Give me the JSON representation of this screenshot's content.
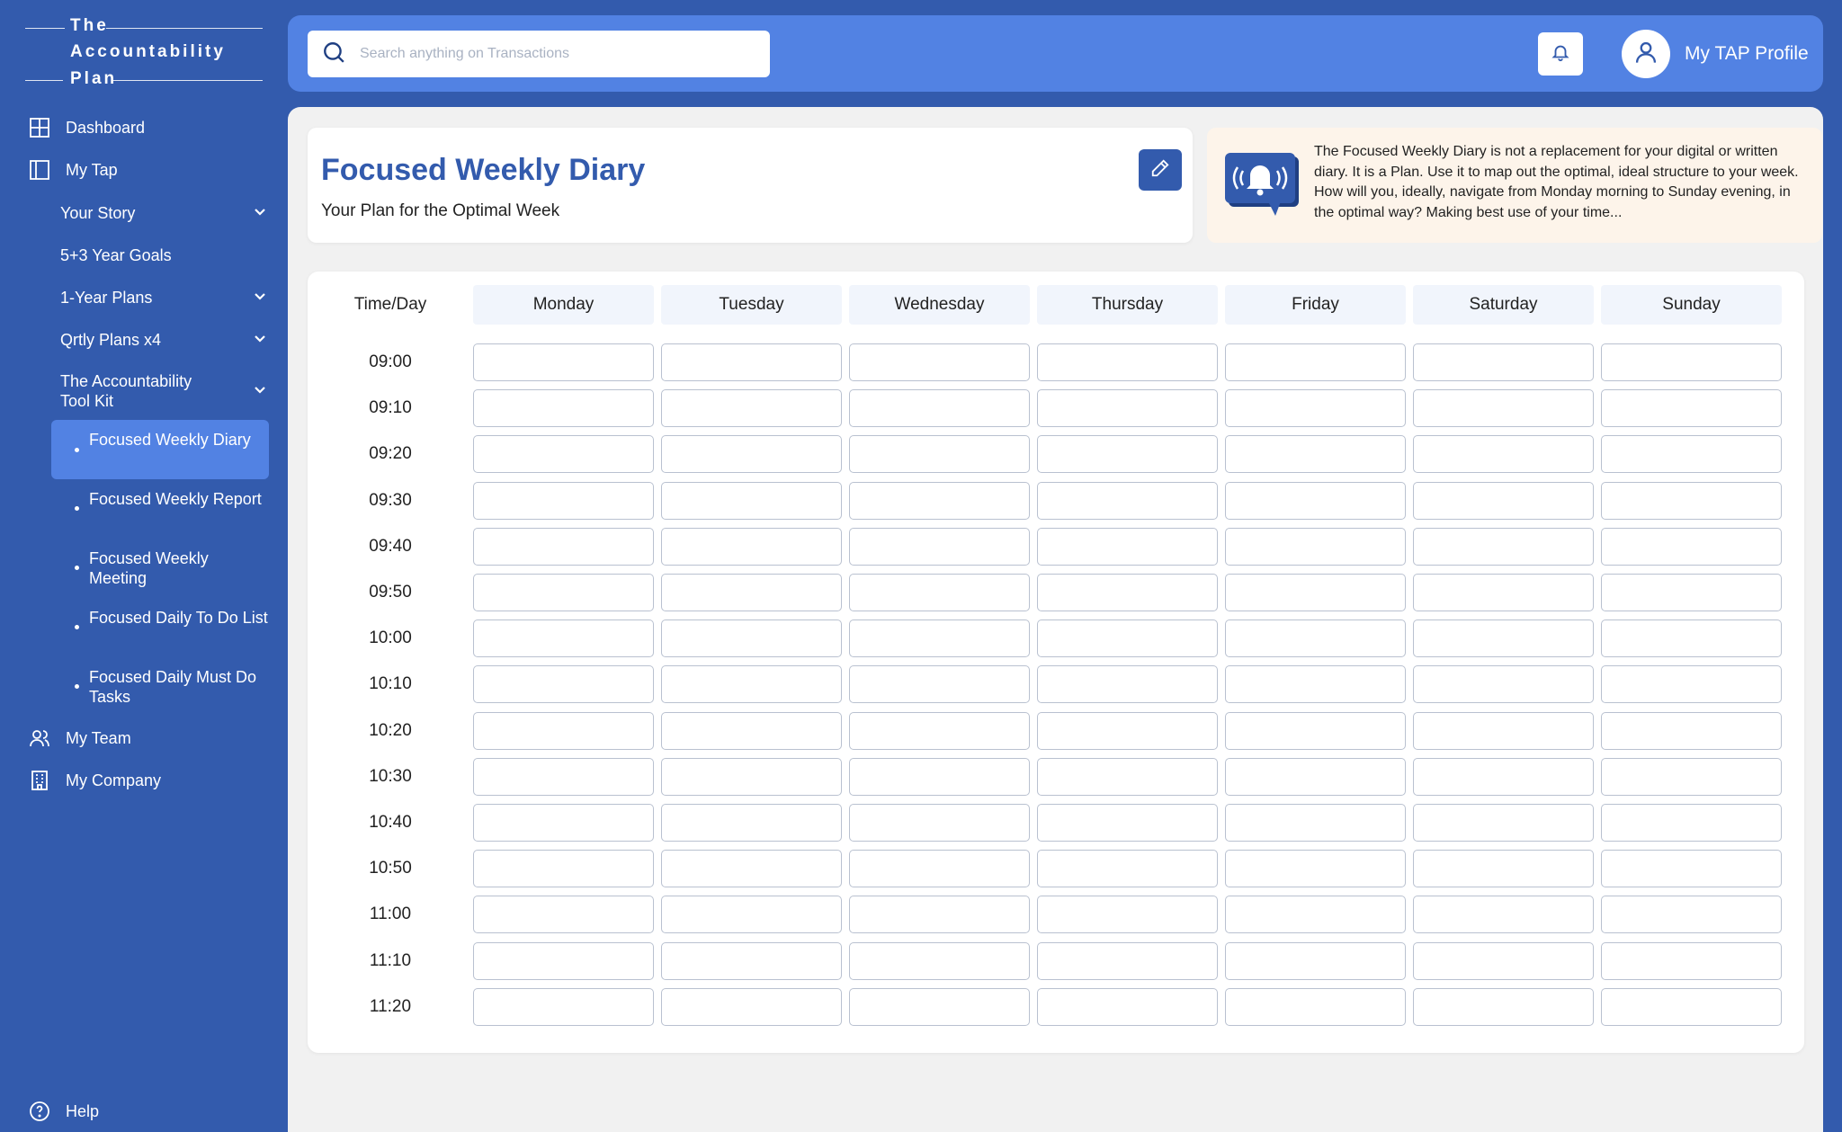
{
  "logo": {
    "line1": "The",
    "line2": "Accountability",
    "line3": "Plan"
  },
  "sidebar": {
    "dashboard": "Dashboard",
    "my_tap": "My Tap",
    "sub_items": [
      "Your Story",
      "5+3 Year Goals",
      "1-Year Plans",
      "Qrtly Plans x4",
      "The Accountability Tool Kit"
    ],
    "toolkit": [
      "Focused Weekly Diary",
      "Focused Weekly Report",
      "Focused Weekly Meeting",
      "Focused Daily To Do List",
      "Focused Daily Must Do Tasks"
    ],
    "my_team": "My Team",
    "my_company": "My Company",
    "help": "Help"
  },
  "topbar": {
    "search_placeholder": "Search anything on Transactions",
    "profile_name": "My TAP Profile"
  },
  "header": {
    "title": "Focused Weekly Diary",
    "subtitle": "Your Plan for the Optimal Week",
    "info": "The Focused Weekly Diary is not a replacement for your digital or written diary. It is a Plan. Use it to map out the optimal, ideal structure to your week. How will you, ideally, navigate from Monday morning to Sunday evening, in the optimal way? Making best use of your time..."
  },
  "grid": {
    "time_header": "Time/Day",
    "days": [
      "Monday",
      "Tuesday",
      "Wednesday",
      "Thursday",
      "Friday",
      "Saturday",
      "Sunday"
    ],
    "times": [
      "09:00",
      "09:10",
      "09:20",
      "09:30",
      "09:40",
      "09:50",
      "10:00",
      "10:10",
      "10:20",
      "10:30",
      "10:40",
      "10:50",
      "11:00",
      "11:10",
      "11:20"
    ]
  },
  "colors": {
    "primary": "#335BAD",
    "accent": "#5282E3",
    "info_bg": "#FDF4EA",
    "content_bg": "#F1F1F1"
  }
}
